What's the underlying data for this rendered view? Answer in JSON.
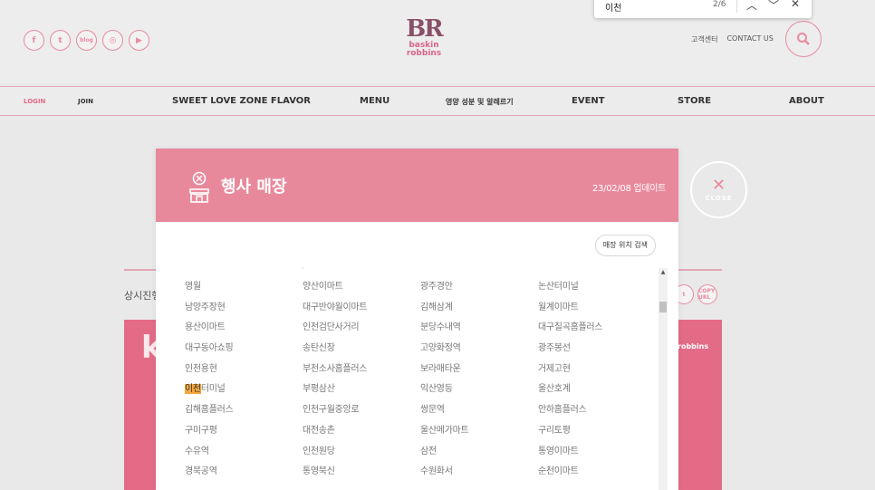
{
  "header": {
    "social": [
      {
        "icon": "facebook-icon",
        "glyph": "f"
      },
      {
        "icon": "twitter-icon",
        "glyph": "t"
      },
      {
        "icon": "blog-icon",
        "glyph": "blog"
      },
      {
        "icon": "instagram-icon",
        "glyph": "◎"
      },
      {
        "icon": "youtube-icon",
        "glyph": "▶"
      }
    ],
    "logo_mark": "BR",
    "logo_name": "baskin robbins",
    "links": [
      "고객센터",
      "CONTACT US"
    ],
    "accent": "#e98aa0"
  },
  "nav": {
    "login": "LOGIN",
    "join": "JOIN",
    "items": [
      "SWEET LOVE ZONE FLAVOR",
      "MENU",
      "영양 성분 및 알레르기",
      "EVENT",
      "STORE",
      "ABOUT"
    ]
  },
  "background": {
    "left_text": "상시진행",
    "block_letter": "k",
    "block_brand": "robbins",
    "copy_label": "COPY URL"
  },
  "modal": {
    "title": "행사 매장",
    "date": "23/02/08 업데이트",
    "location_button": "매장 위치 검색",
    "close_label": "CLOSE",
    "header_color": "#e8899b",
    "rows": [
      [
        "영월",
        "양산이마트",
        "광주경안",
        "논산터미널"
      ],
      [
        "남양주장현",
        "대구반야월이마트",
        "김해삼계",
        "월계이마트"
      ],
      [
        "용산이마트",
        "인천검단사거리",
        "분당수내역",
        "대구칠곡홈플러스"
      ],
      [
        "대구동아쇼핑",
        "송탄신장",
        "고양화정역",
        "광주봉선"
      ],
      [
        "인천용현",
        "부천소사홈플러스",
        "보라매타운",
        "거제고현"
      ],
      [
        "이천터미널",
        "부평삼산",
        "익산영등",
        "울산호계"
      ],
      [
        "김해홈플러스",
        "인천구월중앙로",
        "쌍문역",
        "안하홈플러스"
      ],
      [
        "구미구평",
        "대전송촌",
        "울산메가마트",
        "구리토평"
      ],
      [
        "수유역",
        "인천원당",
        "삼전",
        "통영이마트"
      ],
      [
        "경북공역",
        "통영북신",
        "수원화서",
        "순천이마트"
      ]
    ],
    "highlight": {
      "row": 5,
      "col": 0,
      "match": "이천",
      "rest": "터미널"
    }
  },
  "findbar": {
    "query": "이천",
    "count": "2/6"
  }
}
